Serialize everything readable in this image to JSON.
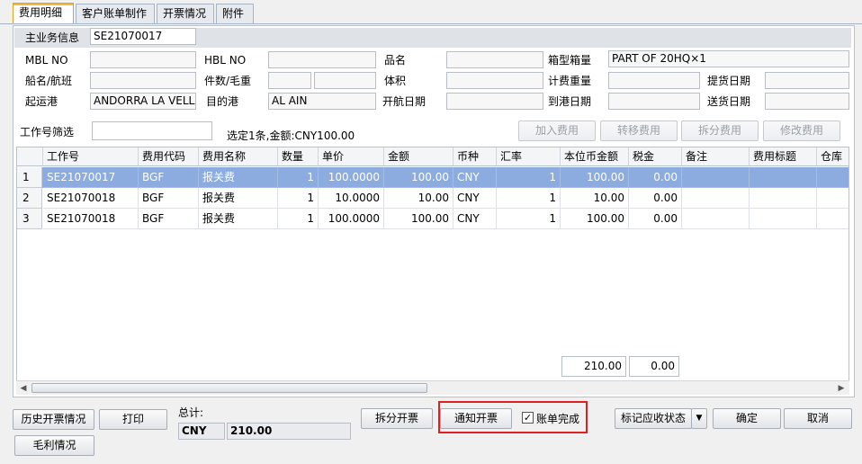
{
  "tabs": [
    "费用明细",
    "客户账单制作",
    "开票情况",
    "附件"
  ],
  "main": {
    "header_label": "主业务信息",
    "job_no": "SE21070017",
    "fields": {
      "mbl_label": "MBL NO",
      "mbl_value": "",
      "hbl_label": "HBL NO",
      "hbl_value": "",
      "product_label": "品名",
      "product_value": "",
      "container_label": "箱型箱量",
      "container_value": "PART OF 20HQ×1",
      "vessel_label": "船名/航班",
      "vessel_value": "",
      "pieces_label": "件数/毛重",
      "pieces_value": "",
      "weight_value": "",
      "volume_label": "体积",
      "volume_value": "",
      "chargeable_label": "计费重量",
      "chargeable_value": "",
      "pickup_label": "提货日期",
      "pickup_value": "",
      "pol_label": "起运港",
      "pol_value": "ANDORRA LA VELLA",
      "pod_label": "目的港",
      "pod_value": "AL AIN",
      "etd_label": "开航日期",
      "etd_value": "",
      "eta_label": "到港日期",
      "eta_value": "",
      "delivery_label": "送货日期",
      "delivery_value": ""
    }
  },
  "filter": {
    "label": "工作号筛选",
    "value": "",
    "summary": "选定1条,金额:CNY100.00"
  },
  "fee_buttons": [
    "加入费用",
    "转移费用",
    "拆分费用",
    "修改费用"
  ],
  "grid": {
    "columns": [
      "工作号",
      "费用代码",
      "费用名称",
      "数量",
      "单价",
      "金额",
      "币种",
      "汇率",
      "本位币金额",
      "税金",
      "备注",
      "费用标题",
      "仓库"
    ],
    "rows": [
      {
        "n": "1",
        "job": "SE21070017",
        "code": "BGF",
        "name": "报关费",
        "qty": "1",
        "price": "100.0000",
        "amount": "100.00",
        "cur": "CNY",
        "rate": "1",
        "base": "100.00",
        "tax": "0.00"
      },
      {
        "n": "2",
        "job": "SE21070018",
        "code": "BGF",
        "name": "报关费",
        "qty": "1",
        "price": "10.0000",
        "amount": "10.00",
        "cur": "CNY",
        "rate": "1",
        "base": "10.00",
        "tax": "0.00"
      },
      {
        "n": "3",
        "job": "SE21070018",
        "code": "BGF",
        "name": "报关费",
        "qty": "1",
        "price": "100.0000",
        "amount": "100.00",
        "cur": "CNY",
        "rate": "1",
        "base": "100.00",
        "tax": "0.00"
      }
    ],
    "selected_row": 1,
    "total_base": "210.00",
    "total_tax": "0.00"
  },
  "footer": {
    "history_btn": "历史开票情况",
    "print_btn": "打印",
    "margin_btn": "毛利情况",
    "total_label": "总计:",
    "total_currency": "CNY",
    "total_amount": "210.00",
    "split_invoice_btn": "拆分开票",
    "notify_invoice_btn": "通知开票",
    "bill_done_label": "账单完成",
    "bill_done_checked": true,
    "mark_status_btn": "标记应收状态",
    "ok_btn": "确定",
    "cancel_btn": "取消"
  },
  "colors": {
    "selected_row": "#8cabdf",
    "highlight_box": "#e02020",
    "active_tab_accent": "#f5b942"
  }
}
